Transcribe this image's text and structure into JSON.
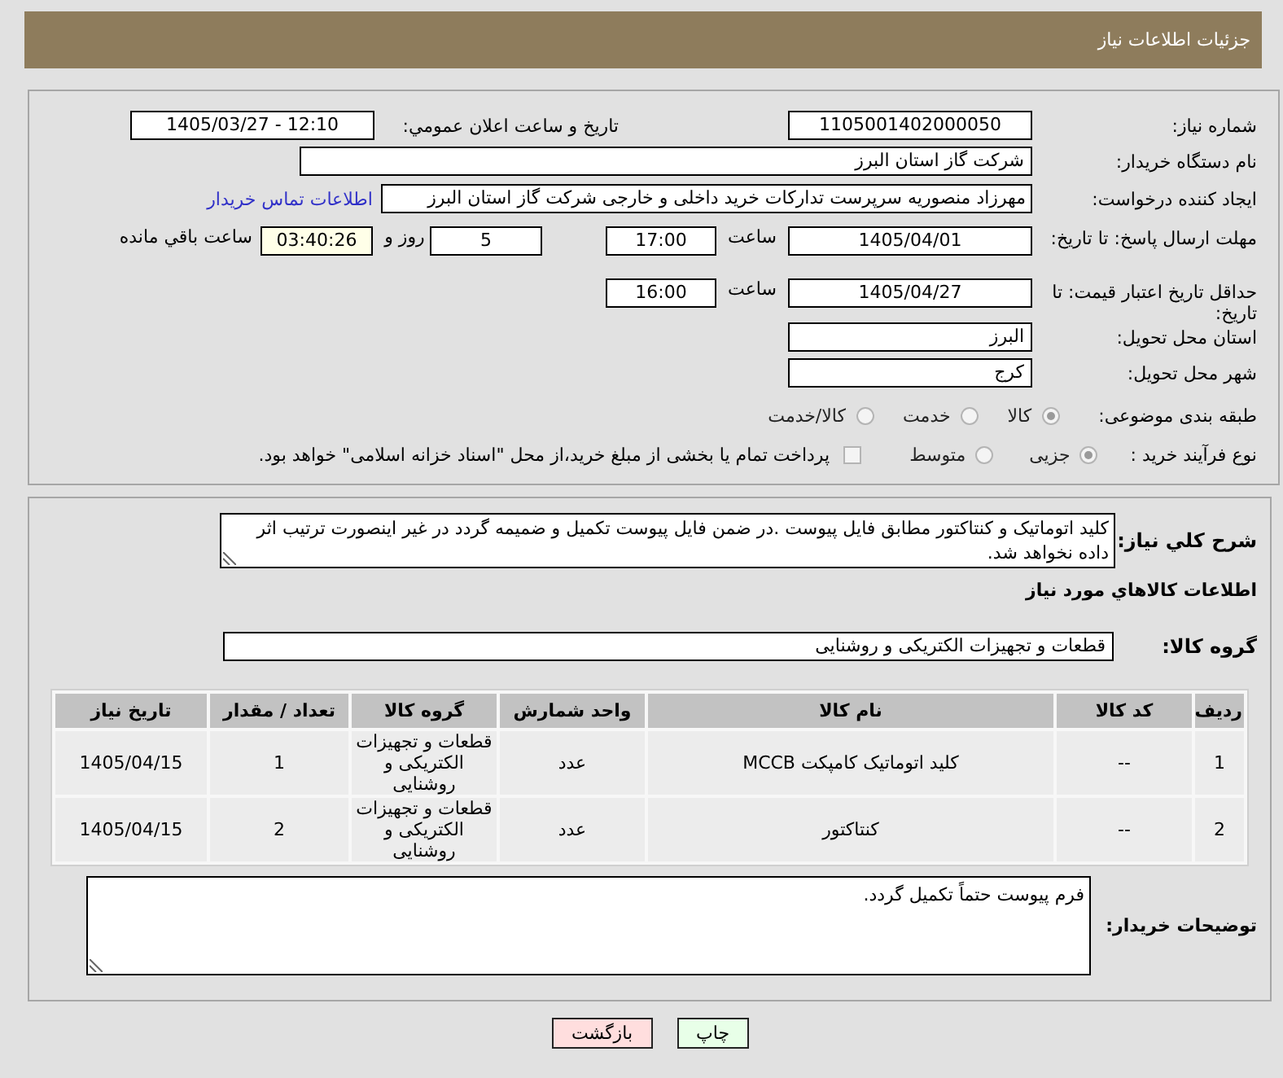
{
  "header": {
    "title": "جزئیات اطلاعات نیاز"
  },
  "general": {
    "need_number": {
      "label": "شماره نیاز:",
      "value": "1105001402000050"
    },
    "announcement": {
      "label": "تاریخ و ساعت اعلان عمومي:",
      "value": "1405/03/27 - 12:10"
    },
    "buyer_org": {
      "label": "نام دستگاه خریدار:",
      "value": "شرکت گاز استان البرز"
    },
    "requester": {
      "label": "ایجاد کننده درخواست:",
      "value": "مهرزاد منصوریه سرپرست تدارکات خرید داخلی و خارجی شرکت گاز استان البرز",
      "contact_link": "اطلاعات تماس خریدار"
    },
    "response_deadline": {
      "label": "مهلت ارسال پاسخ: تا تاریخ:",
      "date": "1405/04/01",
      "time_label": "ساعت",
      "time": "17:00",
      "days": "5",
      "days_label": "روز و",
      "remaining_time": "03:40:26",
      "remaining_label": "ساعت باقي مانده"
    },
    "price_validity": {
      "label": "حداقل تاریخ اعتبار قیمت: تا تاریخ:",
      "date": "1405/04/27",
      "time_label": "ساعت",
      "time": "16:00"
    },
    "delivery_province": {
      "label": "استان محل تحویل:",
      "value": "البرز"
    },
    "delivery_city": {
      "label": "شهر محل تحویل:",
      "value": "کرج"
    },
    "category": {
      "label": "طبقه بندی موضوعی:",
      "options": [
        {
          "label": "کالا",
          "selected": true
        },
        {
          "label": "خدمت",
          "selected": false
        },
        {
          "label": "کالا/خدمت",
          "selected": false
        }
      ]
    },
    "process_type": {
      "label": "نوع فرآیند خرید :",
      "options": [
        {
          "label": "جزیی",
          "selected": true
        },
        {
          "label": "متوسط",
          "selected": false
        }
      ],
      "treasury_payment": {
        "label": "پرداخت تمام یا بخشی از مبلغ خرید،از محل \"اسناد خزانه اسلامی\" خواهد بود.",
        "checked": false
      }
    }
  },
  "goods": {
    "description": {
      "label": "شرح کلي نیاز:",
      "value": "کلید اتوماتیک و کنتاکتور مطابق فایل پیوست .در ضمن فایل پیوست تکمیل و ضمیمه گردد در غیر اینصورت ترتیب اثر داده نخواهد شد."
    },
    "section_title": "اطلاعات کالاهاي مورد نیاز",
    "goods_group": {
      "label": "گروه کالا:",
      "value": "قطعات و تجهیزات الکتریکی و روشنایی"
    },
    "table": {
      "columns": [
        "ردیف",
        "کد کالا",
        "نام کالا",
        "واحد شمارش",
        "گروه کالا",
        "تعداد / مقدار",
        "تاریخ نیاز"
      ],
      "rows": [
        [
          "1",
          "--",
          "کلید اتوماتیک کامپکت MCCB",
          "عدد",
          "قطعات و تجهیزات الکتریکی و روشنایی",
          "1",
          "1405/04/15"
        ],
        [
          "2",
          "--",
          "کنتاکتور",
          "عدد",
          "قطعات و تجهیزات الکتریکی و روشنایی",
          "2",
          "1405/04/15"
        ]
      ]
    },
    "buyer_notes": {
      "label": "توضیحات خریدار:",
      "value": "فرم پیوست حتماً تکمیل گردد."
    }
  },
  "buttons": [
    {
      "label": "چاپ",
      "kind": "print"
    },
    {
      "label": "بازگشت",
      "kind": "back"
    }
  ]
}
